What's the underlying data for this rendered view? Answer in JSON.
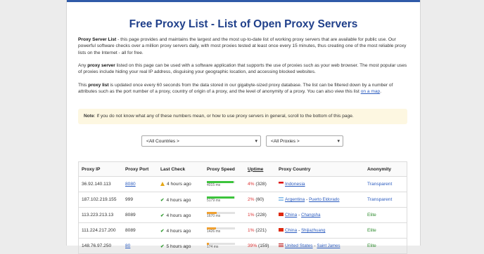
{
  "title": "Free Proxy List - List of Open Proxy Servers",
  "intro": {
    "p1_bold": "Proxy Server List",
    "p1_text": " - this page provides and maintains the largest and the most up-to-date list of working proxy servers that are available for public use. Our powerful software checks over a million proxy servers daily, with most proxies tested at least once every 15 minutes, thus creating one of the most reliable proxy lists on the Internet - all for free.",
    "p2_pre": "Any ",
    "p2_bold": "proxy server",
    "p2_text": " listed on this page can be used with a software application that supports the use of proxies such as your web browser. The most popular uses of proxies include hiding your real IP address, disguising your geographic location, and accessing blocked websites.",
    "p3_pre": "This ",
    "p3_bold": "proxy list",
    "p3_text": " is updated once every 60 seconds from the data stored in our gigabyte-sized proxy database. The list can be filtered down by a number of attributes such as the port number of a proxy, country of origin of a proxy, and the level of anonymity of a proxy. You can also view this list ",
    "p3_link": "on a map",
    "p3_end": "."
  },
  "note": {
    "label": "Note",
    "text": ": If you do not know what any of these numbers mean, or how to use proxy servers in general, scroll to the bottom of this page."
  },
  "filters": {
    "countries": "<All Countries >",
    "proxies": "<All Proxies >"
  },
  "table": {
    "headers": [
      "Proxy IP",
      "Proxy Port",
      "Last Check",
      "Proxy Speed",
      "Uptime",
      "Proxy Country",
      "Anonymity"
    ],
    "rows": [
      {
        "ip": "36.92.140.113",
        "port": "8080",
        "port_link": true,
        "check_status": "warn",
        "last_check": "4 hours ago",
        "speed_ms": "4015 ms",
        "speed_fill": 0.95,
        "speed_color": "#3cc43c",
        "uptime_pct": "4%",
        "uptime_count": "(328)",
        "uptime_color": "red",
        "flag": "id",
        "country": "Indonesia",
        "city": "",
        "anonymity": "Transparent",
        "anon_color": "blue"
      },
      {
        "ip": "187.102.219.155",
        "port": "999",
        "port_link": false,
        "check_status": "ok",
        "last_check": "4 hours ago",
        "speed_ms": "5179 ms",
        "speed_fill": 0.98,
        "speed_color": "#3cc43c",
        "uptime_pct": "2%",
        "uptime_count": "(60)",
        "uptime_color": "red",
        "flag": "ar",
        "country": "Argentina",
        "city": "Puerto Eldorado",
        "anonymity": "Transparent",
        "anon_color": "blue"
      },
      {
        "ip": "113.223.213.13",
        "port": "8089",
        "port_link": false,
        "check_status": "ok",
        "last_check": "4 hours ago",
        "speed_ms": "1670 ms",
        "speed_fill": 0.35,
        "speed_color": "#f0a030",
        "uptime_pct": "1%",
        "uptime_count": "(228)",
        "uptime_color": "red",
        "flag": "cn",
        "country": "China",
        "city": "Changsha",
        "anonymity": "Elite",
        "anon_color": "green"
      },
      {
        "ip": "111.224.217.200",
        "port": "8089",
        "port_link": false,
        "check_status": "ok",
        "last_check": "4 hours ago",
        "speed_ms": "1426 ms",
        "speed_fill": 0.32,
        "speed_color": "#f0a030",
        "uptime_pct": "1%",
        "uptime_count": "(221)",
        "uptime_color": "red",
        "flag": "cn",
        "country": "China",
        "city": "Shijiazhuang",
        "anonymity": "Elite",
        "anon_color": "green"
      },
      {
        "ip": "148.76.97.250",
        "port": "80",
        "port_link": true,
        "check_status": "ok",
        "last_check": "5 hours ago",
        "speed_ms": "174 ms",
        "speed_fill": 0.08,
        "speed_color": "#f0a030",
        "uptime_pct": "39%",
        "uptime_count": "(159)",
        "uptime_color": "red",
        "flag": "us",
        "country": "United States",
        "city": "Saint James",
        "anonymity": "Elite",
        "anon_color": "green"
      }
    ]
  }
}
